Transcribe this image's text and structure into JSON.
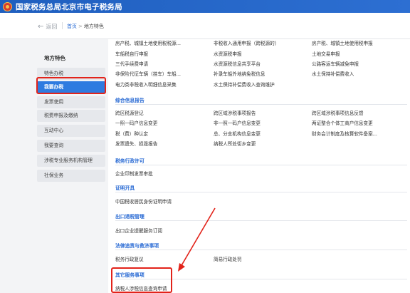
{
  "header": {
    "title": "国家税务总局北京市电子税务局"
  },
  "nav": {
    "back_label": "返回",
    "breadcrumb_home": "首页",
    "breadcrumb_sep": ">",
    "breadcrumb_current": "地方特色"
  },
  "sidebar": {
    "title": "地方特色",
    "items": [
      {
        "label": "特色办税"
      },
      {
        "label": "我要办税"
      },
      {
        "label": "发票使用"
      },
      {
        "label": "税费申报及缴纳"
      },
      {
        "label": "互动中心"
      },
      {
        "label": "我要查询"
      },
      {
        "label": "涉税专业服务机构管理"
      },
      {
        "label": "社保业务"
      }
    ]
  },
  "top_rows": [
    [
      "房产税、城镇土地使用税税源...",
      "非税收入通用申报（跨税源的）",
      "房产税、城镇土地使用税申报"
    ],
    [
      "车船税自行申报",
      "水资源税申报",
      "土地交易申报"
    ],
    [
      "三代手续费申请",
      "水资源税信息共享平台",
      "公路客运车辆减免申报"
    ],
    [
      "非保险代征车辆（挂车）车船...",
      "补录车船外地纳免税信息",
      "水土保持补偿费收入"
    ],
    [
      "电力类非税收入明细信息采集",
      "水土保持补偿费收入查询维护",
      ""
    ]
  ],
  "sections": [
    {
      "title": "综合信息报告",
      "rows": [
        [
          "跨区税源登记",
          "跨区域涉税事项报告",
          "跨区域涉税事项信息反馈"
        ],
        [
          "一照一码户信息变更",
          "非一照一码户信息变更",
          "两证整合个体工商户信息变更"
        ],
        [
          "税（费）种认定",
          "总、分支机构信息变更",
          "财务会计制度及核算软件备案..."
        ],
        [
          "发票遗失、损毁报告",
          "纳税人所处街乡变更",
          ""
        ]
      ]
    },
    {
      "title": "税务行政许可",
      "rows": [
        [
          "企业印制发票审批",
          "",
          ""
        ]
      ]
    },
    {
      "title": "证明开具",
      "rows": [
        [
          "中国税收居民身份证明申请",
          "",
          ""
        ]
      ]
    },
    {
      "title": "出口退税管理",
      "rows": [
        [
          "出口企业提醒服务订阅",
          "",
          ""
        ]
      ]
    },
    {
      "title": "法律追责与救济事项",
      "rows": [
        [
          "税务行政复议",
          "简易行政处罚",
          ""
        ]
      ]
    },
    {
      "title": "其它服务事项",
      "rows": [
        [
          "纳税人涉税信息查询申请",
          "",
          ""
        ]
      ]
    }
  ],
  "colors": {
    "accent": "#2a6bd4",
    "header_bg": "#1f5fbf",
    "highlight_red": "#e2231a",
    "active_bg": "#2e7be0"
  }
}
